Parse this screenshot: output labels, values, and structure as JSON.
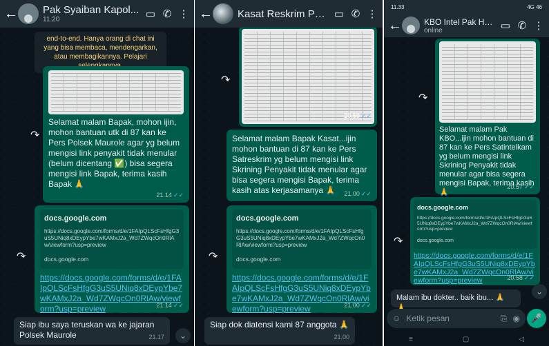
{
  "panel1": {
    "title": "Pak Syaiban Kapol...",
    "subtitle": "11.20",
    "banner": "end-to-end. Hanya orang di chat ini yang bisa membaca, mendengarkan, atau membagikannya. Pelajari selengkapnya.",
    "msg1": "Selamat malam Bapak, mohon ijin, mohon bantuan utk di 87 kan ke Pers Polsek Maurole agar yg belum mengisi link penyakit tidak menular (belum dicentang ✅) bisa segera mengisi link Bapak, terima kasih Bapak 🙏",
    "msg1_time": "21.14",
    "card_title": "docs.google.com",
    "card_url": "https://docs.google.com/forms/d/e/1FAIpQLScFsHfgG3uS5UNiq8xDEypYbe7wKAMxJ2a_Wd7ZWqcOn0RlAw/viewform?usp=preview",
    "card_domain": "docs.google.com",
    "link": "https://docs.google.com/forms/d/e/1FAIpQLScFsHfgG3uS5UNiq8xDEypYbe7wKAMxJ2a_Wd7ZWqcOn0RlAw/viewform?usp=preview",
    "link_time": "21.14",
    "reply": "Siap ibu saya teruskan wa ke jajaran Polsek Maurole",
    "reply_time": "21.17"
  },
  "panel2": {
    "title": "Kasat Reskrim Pol...",
    "img_time": "20.59",
    "msg1": "Selamat malam Bapak Kasat...ijin mohon bantuan di 87 kan ke Pers Satreskrim yg belum mengisi link Skrining Penyakit tidak menular agar bisa segera mengisi Bapak, terima kasih atas kerjasamanya 🙏",
    "msg1_time": "21.00",
    "card_title": "docs.google.com",
    "card_url": "https://docs.google.com/forms/d/e/1FAIpQLScFsHfgG3uS5UNiq8xDEypYbe7wKAMxJ2a_Wd7ZWqcOn0RlAw/viewform?usp=preview",
    "card_domain": "docs.google.com",
    "link": "https://docs.google.com/forms/d/e/1FAIpQLScFsHfgG3uS5UNiq8xDEypYbe7wKAMxJ2a_Wd7ZWqcOn0RlAw/viewform?usp=preview",
    "link_time": "21.00",
    "reply": "Siap dok diatensi kami 87 anggota 🙏",
    "reply_time": "21.00"
  },
  "panel3": {
    "status_time": "11.33",
    "status_right": "4G 46",
    "title": "KBO Intel Pak Har...",
    "subtitle": "online",
    "msg1": "Selamat malam Pak KBO...ijin mohon bantuan di 87 kan ke Pers Satintelkam yg belum mengisi link Skrining Penyakit tidak menular agar bisa segera mengisi Bapak, terima kasih 🙏",
    "msg1_time": "20.57",
    "card_title": "docs.google.com",
    "card_url": "https://docs.google.com/forms/d/e/1FAIpQLScFsHfgG3uS5UNiq8xDEypYbe7wKAMxJ2a_Wd7ZWqcOn0RlAw/viewform?usp=preview",
    "card_domain": "docs.google.com",
    "link": "https://docs.google.com/forms/d/e/1FAIpQLScFsHfgG3uS5UNiq8xDEypYbe7wKAMxJ2a_Wd7ZWqcOn0RlAw/viewform?usp=preview",
    "link_time": "20.58",
    "reply": "Malam ibu dokter.. baik ibu... 🙏 🙏",
    "input_placeholder": "Ketik pesan"
  },
  "icons": {
    "back": "←",
    "video": "▭",
    "call": "✆",
    "menu": "⋮",
    "forward": "↷",
    "chevron": "⌄",
    "emoji": "☺",
    "attach": "⎘",
    "camera": "◉",
    "mic": "🎤",
    "nav_menu": "≡",
    "nav_home": "▢",
    "nav_back": "◁"
  },
  "colors": {
    "outgoing": "#005c4b",
    "incoming": "#1f2c34",
    "link": "#53bdeb",
    "accent": "#00a884"
  }
}
